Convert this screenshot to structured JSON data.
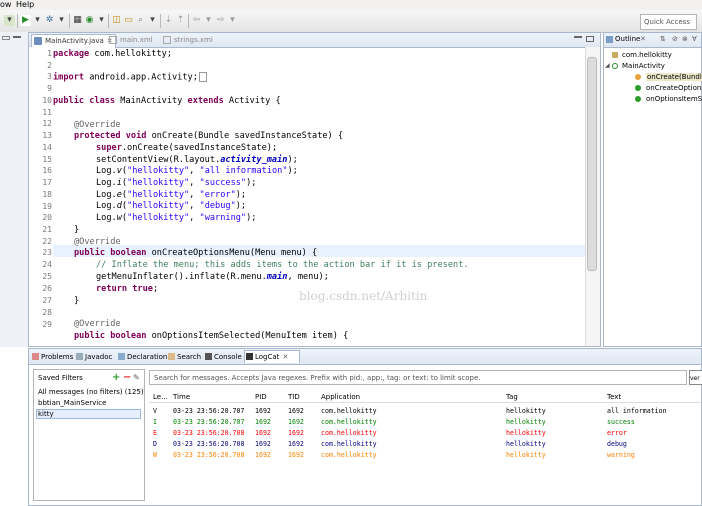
{
  "menu": {
    "items": [
      "ow",
      "Help"
    ]
  },
  "toolbar": {
    "quick_access": "Quick Access"
  },
  "editor": {
    "tabs": [
      {
        "label": "MainActivity.java",
        "active": true
      },
      {
        "label": "main.xml",
        "active": false
      },
      {
        "label": "strings.xml",
        "active": false
      }
    ],
    "watermark": "blog.csdn.net/Arbitin"
  },
  "outline": {
    "title": "Outline",
    "items": [
      "com.hellokitty",
      "MainActivity",
      "onCreate(Bundle)",
      "onCreateOptionsM",
      "onOptionsItemSel"
    ]
  },
  "bottom": {
    "tabs": [
      "Problems",
      "Javadoc",
      "Declaration",
      "Search",
      "Console",
      "LogCat"
    ],
    "saved_filters_label": "Saved Filters",
    "filters": [
      "All messages (no filters) (125)",
      "bbtian_MainService",
      "kitty"
    ],
    "search_placeholder": "Search for messages. Accepts Java regexes. Prefix with pid:, app:, tag: or text: to limit scope.",
    "verbose": "ver",
    "columns": [
      "Le...",
      "Time",
      "PID",
      "TID",
      "Application",
      "Tag",
      "Text"
    ],
    "rows": [
      {
        "level": "V",
        "time": "03-23 23:56:20.707",
        "pid": "1692",
        "tid": "1692",
        "app": "com.hellokitty",
        "tag": "hellokitty",
        "text": "all information",
        "color": "#000000"
      },
      {
        "level": "I",
        "time": "03-23 23:56:20.707",
        "pid": "1692",
        "tid": "1692",
        "app": "com.hellokitty",
        "tag": "hellokitty",
        "text": "success",
        "color": "#008000"
      },
      {
        "level": "E",
        "time": "03-23 23:56:20.708",
        "pid": "1692",
        "tid": "1692",
        "app": "com.hellokitty",
        "tag": "hellokitty",
        "text": "error",
        "color": "#ff0000"
      },
      {
        "level": "D",
        "time": "03-23 23:56:20.708",
        "pid": "1692",
        "tid": "1692",
        "app": "com.hellokitty",
        "tag": "hellokitty",
        "text": "debug",
        "color": "#00007f"
      },
      {
        "level": "W",
        "time": "03-23 23:56:20.708",
        "pid": "1692",
        "tid": "1692",
        "app": "com.hellokitty",
        "tag": "hellokitty",
        "text": "warning",
        "color": "#ff8000"
      }
    ]
  },
  "code": {
    "numbers": [
      "1",
      "2",
      "3",
      "9",
      "10",
      "11",
      "12",
      "13",
      "14",
      "15",
      "16",
      "17",
      "18",
      "19",
      "20",
      "21",
      "22",
      "23",
      "24",
      "25",
      "26",
      "27",
      "28",
      "29"
    ],
    "l1_kw": "package",
    "l1_rest": " com.hellokitty;",
    "l3_kw": "import",
    "l3_rest": " android.app.Activity;",
    "l9_kw1": "public class",
    "l9_mid": " MainActivity ",
    "l9_kw2": "extends",
    "l9_rest": " Activity {",
    "l11": "@Override",
    "l12_kw": "protected void",
    "l12_rest": " onCreate(Bundle ",
    "l12_param": "savedInstanceState",
    "l12_end": ") {",
    "l13_kw": "super",
    "l13_mid": ".onCreate(",
    "l13_param": "savedInstanceState",
    "l13_end": ");",
    "l14_a": "setContentView(R.layout.",
    "l14_f": "activity_main",
    "l14_b": ");",
    "log_prefix": "Log.",
    "logs": [
      {
        "m": "v",
        "tag": "\"hellokitty\"",
        "msg": "\"all information\""
      },
      {
        "m": "i",
        "tag": "\"hellokitty\"",
        "msg": "\"success\""
      },
      {
        "m": "e",
        "tag": "\"hellokitty\"",
        "msg": "\"error\""
      },
      {
        "m": "d",
        "tag": "\"hellokitty\"",
        "msg": "\"debug\""
      },
      {
        "m": "w",
        "tag": "\"hellokitty\"",
        "msg": "\"warning\""
      }
    ],
    "close_brace": "}",
    "l21": "@Override",
    "l22_kw": "public boolean",
    "l22_a": " onCreateOptionsMenu(Menu ",
    "l22_p": "menu",
    "l22_b": ") {",
    "l23": "// Inflate the menu; this adds items to the action bar if it is present.",
    "l24_a": "getMenuInflater().inflate(R.menu.",
    "l24_f": "main",
    "l24_b": ", ",
    "l24_p": "menu",
    "l24_c": ");",
    "l25_kw": "return",
    "l25_kw2": "true",
    "l25_end": ";",
    "l28": "@Override",
    "l29_kw": "public boolean",
    "l29_a": " onOptionsItemSelected(MenuItem ",
    "l29_p": "item",
    "l29_b": ") {"
  },
  "colors": {
    "accent_blue": "#a9b8cd",
    "annotation_green": "#2e8b57"
  }
}
